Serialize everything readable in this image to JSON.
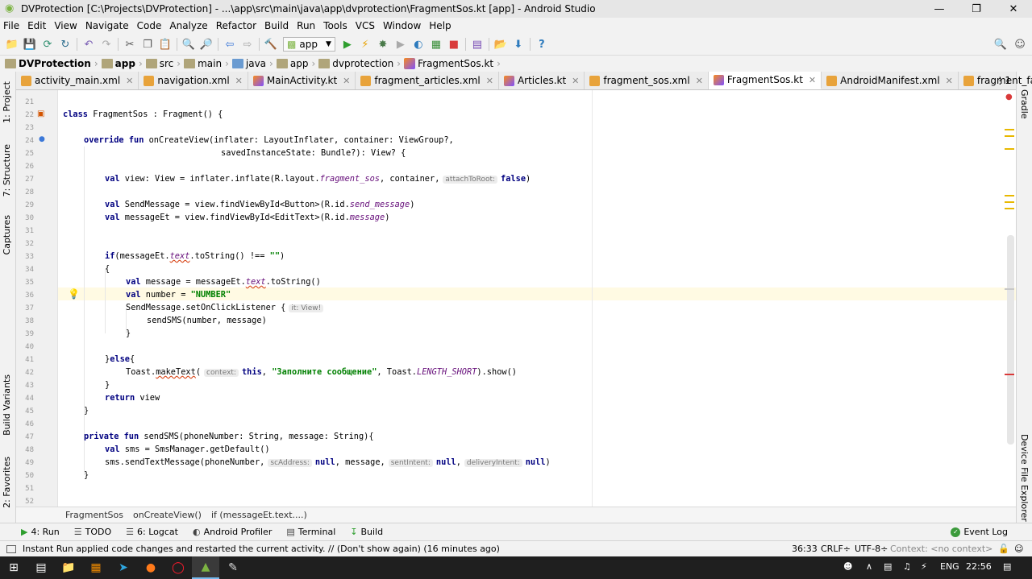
{
  "window": {
    "title": "DVProtection [C:\\Projects\\DVProtection] - ...\\app\\src\\main\\java\\app\\dvprotection\\FragmentSos.kt [app] - Android Studio"
  },
  "menu": [
    "File",
    "Edit",
    "View",
    "Navigate",
    "Code",
    "Analyze",
    "Refactor",
    "Build",
    "Run",
    "Tools",
    "VCS",
    "Window",
    "Help"
  ],
  "toolbar": {
    "run_config": "app"
  },
  "breadcrumb": [
    "DVProtection",
    "app",
    "src",
    "main",
    "java",
    "app",
    "dvprotection",
    "FragmentSos.kt"
  ],
  "tabs": [
    {
      "label": "activity_main.xml",
      "type": "xml"
    },
    {
      "label": "navigation.xml",
      "type": "xml"
    },
    {
      "label": "MainActivity.kt",
      "type": "kt"
    },
    {
      "label": "fragment_articles.xml",
      "type": "xml"
    },
    {
      "label": "Articles.kt",
      "type": "kt"
    },
    {
      "label": "fragment_sos.xml",
      "type": "xml"
    },
    {
      "label": "FragmentSos.kt",
      "type": "kt"
    },
    {
      "label": "AndroidManifest.xml",
      "type": "xml"
    },
    {
      "label": "fragment_faq.xml",
      "type": "xml"
    }
  ],
  "tabs_overflow": "⋮1",
  "side_tools_left": [
    "1: Project",
    "7: Structure",
    "Captures",
    "Build Variants",
    "2: Favorites"
  ],
  "side_tools_right": [
    "Gradle",
    "Device File Explorer"
  ],
  "code_lines": {
    "l21": "21",
    "l22": "22",
    "l23": "23",
    "l24": "24",
    "l25": "25",
    "l26": "26",
    "l27": "27",
    "l28": "28",
    "l29": "29",
    "l30": "30",
    "l31": "31",
    "l32": "32",
    "l33": "33",
    "l34": "34",
    "l35": "35",
    "l36": "36",
    "l37": "37",
    "l38": "38",
    "l39": "39",
    "l40": "40",
    "l41": "41",
    "l42": "42",
    "l43": "43",
    "l44": "44",
    "l45": "45",
    "l46": "46",
    "l47": "47",
    "l48": "48",
    "l49": "49",
    "l50": "50",
    "l51": "51",
    "l52": "52"
  },
  "code": {
    "c22a": "class",
    "c22b": " FragmentSos : Fragment() {",
    "c24a": "override fun",
    "c24b": " onCreateView(inflater: LayoutInflater, container: ViewGroup?,",
    "c25": "savedInstanceState: Bundle?): View? {",
    "c27a": "val",
    "c27b": " view: View = inflater.inflate(R.layout.",
    "c27c": "fragment_sos",
    "c27d": ", container,",
    "c27h": "attachToRoot:",
    "c27e": "false",
    "c27f": ")",
    "c29a": "val",
    "c29b": " SendMessage = view.findViewById<Button>(R.id.",
    "c29c": "send_message",
    "c29d": ")",
    "c30a": "val",
    "c30b": " messageEt = view.findViewById<EditText>(R.id.",
    "c30c": "message",
    "c30d": ")",
    "c33a": "if",
    "c33b": "(messageEt.",
    "c33c": "text",
    "c33d": ".toString() !== ",
    "c33e": "\"\"",
    "c33f": ")",
    "c34": "{",
    "c35a": "val",
    "c35b": " message = messageEt.",
    "c35c": "text",
    "c35d": ".toString()",
    "c36a": "val",
    "c36b": " number = ",
    "c36c": "\"NUMBER\"",
    "c37a": "SendMessage.setOnClickListener {",
    "c37h": "it: View!",
    "c38": "sendSMS(number, message)",
    "c39": "}",
    "c41a": "}",
    "c41b": "else",
    "c41c": "{",
    "c42a": "Toast.",
    "c42b": "makeText",
    "c42c": "(",
    "c42h": "context:",
    "c42d": "this",
    "c42e": ", ",
    "c42f": "\"Заполните сообщение\"",
    "c42g": ", Toast.",
    "c42i": "LENGTH_SHORT",
    "c42j": ").show()",
    "c43": "}",
    "c44a": "return",
    "c44b": " view",
    "c45": "}",
    "c47a": "private fun",
    "c47b": " sendSMS(phoneNumber: String, message: String){",
    "c48a": "val",
    "c48b": " sms = SmsManager.getDefault()",
    "c49a": "sms.sendTextMessage(phoneNumber,",
    "c49h1": "scAddress:",
    "c49b": "null",
    "c49c": ", message,",
    "c49h2": "sentIntent:",
    "c49d": "null",
    "c49e": ",",
    "c49h3": "deliveryIntent:",
    "c49f": "null",
    "c49g": ")",
    "c50": "}"
  },
  "editor_breadcrumb": [
    "FragmentSos",
    "onCreateView()",
    "if (messageEt.text....)"
  ],
  "tool_windows": [
    {
      "label": "4: Run",
      "icon": "run-icon"
    },
    {
      "label": "TODO",
      "icon": "todo-icon"
    },
    {
      "label": "6: Logcat",
      "icon": "logcat-icon"
    },
    {
      "label": "Android Profiler",
      "icon": "profiler-icon"
    },
    {
      "label": "Terminal",
      "icon": "terminal-icon"
    },
    {
      "label": "Build",
      "icon": "build-icon"
    }
  ],
  "event_log": "Event Log",
  "status": {
    "message": "Instant Run applied code changes and restarted the current activity. // (Don't show again) (16 minutes ago)",
    "position": "36:33",
    "line_sep": "CRLF÷",
    "encoding": "UTF-8÷",
    "context": "Context: <no context>"
  },
  "taskbar": {
    "lang": "ENG",
    "time": "22:56"
  },
  "colors": {
    "keyword": "#000080",
    "string": "#008000",
    "field": "#660e7a",
    "caret_line": "#fffae3"
  }
}
